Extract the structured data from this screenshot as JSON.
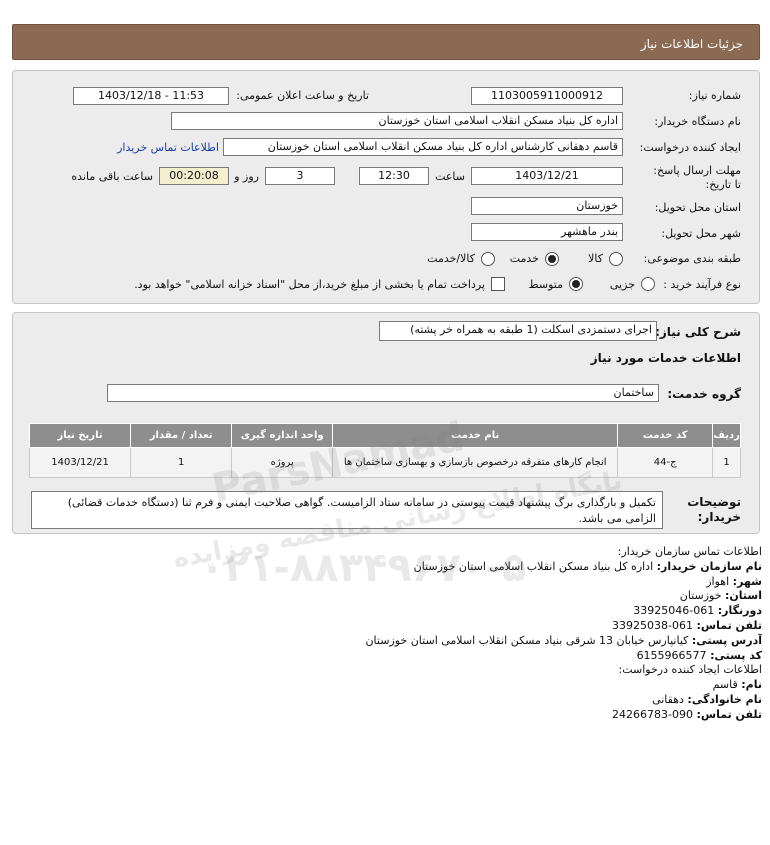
{
  "header": {
    "title": "جزئیات اطلاعات نیاز"
  },
  "form": {
    "need_number_label": "شماره نیاز:",
    "need_number": "1103005911000912",
    "announce_label": "تاریخ و ساعت اعلان عمومی:",
    "announce_value": "1403/12/18 - 11:53",
    "buyer_org_label": "نام دستگاه خریدار:",
    "buyer_org": "اداره کل بنیاد مسکن انقلاب اسلامی استان خوزستان",
    "creator_label": "ایجاد کننده درخواست:",
    "creator": "قاسم دهقانی کارشناس اداره کل بنیاد مسکن انقلاب اسلامی استان خوزستان",
    "contact_link": "اطلاعات تماس خریدار",
    "deadline_label": "مهلت ارسال پاسخ: تا تاریخ:",
    "deadline_date": "1403/12/21",
    "time_label": "ساعت",
    "deadline_time": "12:30",
    "days_value": "3",
    "days_label": "روز و",
    "remaining_time": "00:20:08",
    "remaining_label": "ساعت باقی مانده",
    "province_label": "استان محل تحویل:",
    "province": "خوزستان",
    "city_label": "شهر محل تحویل:",
    "city": "بندر ماهشهر",
    "category_label": "طبقه بندی موضوعی:",
    "category_options": [
      "کالا",
      "خدمت",
      "کالا/خدمت"
    ],
    "category_selected": "خدمت",
    "process_label": "نوع فرآیند خرید :",
    "process_options": [
      "جزیی",
      "متوسط"
    ],
    "process_selected": "متوسط",
    "payment_text": "پرداخت تمام یا بخشی از مبلغ خرید،از محل \"اسناد خزانه اسلامی\" خواهد بود."
  },
  "details": {
    "summary_label": "شرح کلی نیاز:",
    "summary": "اجرای دستمزدی اسکلت (1 طبقه به همراه خر پشته)",
    "services_heading": "اطلاعات خدمات مورد نیاز",
    "service_group_label": "گروه خدمت:",
    "service_group": "ساختمان",
    "table_headers": [
      "ردیف",
      "کد خدمت",
      "نام خدمت",
      "واحد اندازه گیری",
      "تعداد / مقدار",
      "تاریخ نیاز"
    ],
    "rows": [
      {
        "row": "1",
        "code": "ج-44",
        "name": "انجام کارهای متفرقه درخصوص بازسازی و بهسازی ساختمان ها",
        "unit": "پروژه",
        "qty": "1",
        "date": "1403/12/21"
      }
    ],
    "buyer_notes_label": "توضیحات خریدار:",
    "buyer_notes": "تکمیل و بارگذاری برگ پیشنهاد قیمت پیوستی در سامانه ستاد الزامیست. گواهی صلاحیت ایمنی و فرم ثنا (دستگاه خدمات قضائی) الزامی می باشد."
  },
  "contact": {
    "org_heading": "اطلاعات تماس سازمان خریدار:",
    "buyer_name_label": "نام سازمان خریدار:",
    "buyer_name": "اداره کل بنیاد مسکن انقلاب اسلامی استان خوزستان",
    "city_label": "شهر:",
    "city": "اهواز",
    "province_label": "استان:",
    "province": "خوزستان",
    "fax_label": "دورنگار:",
    "fax": "061-33925046",
    "phone_label": "تلفن تماس:",
    "phone": "061-33925038",
    "address_label": "آدرس پستی:",
    "address": "کیانپارس خیابان 13 شرقی بنیاد مسکن انقلاب اسلامی استان خوزستان",
    "postal_label": "کد پستی:",
    "postal": "6155966577",
    "creator_heading": "اطلاعات ایجاد کننده درخواست:",
    "first_name_label": "نام:",
    "first_name": "قاسم",
    "last_name_label": "نام خانوادگی:",
    "last_name": "دهقانی",
    "creator_phone_label": "تلفن تماس:",
    "creator_phone": "090-24266783"
  },
  "watermark": {
    "brand": "ParsNamad",
    "line1": "پایگاه اطلاع رسانی مناقصه ومزایده",
    "phone": "۰۲۱-۸۸۳۴۹۶۷۰-۵"
  }
}
